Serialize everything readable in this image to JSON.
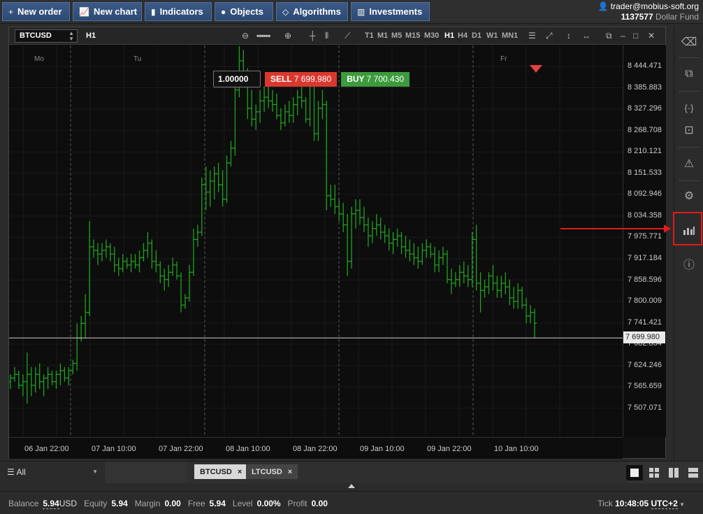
{
  "toolbar": {
    "new_order": "New order",
    "new_chart": "New chart",
    "indicators": "Indicators",
    "objects": "Objects",
    "algorithms": "Algorithms",
    "investments": "Investments"
  },
  "account": {
    "user": "trader@mobius-soft.org",
    "number": "1137577",
    "fund": "Dollar Fund"
  },
  "chart": {
    "symbol": "BTCUSD",
    "timeframe": "H1",
    "timeframes": [
      "T1",
      "M1",
      "M5",
      "M15",
      "M30",
      "H1",
      "H4",
      "D1",
      "W1",
      "MN1"
    ],
    "active_timeframe": "H1",
    "quantity": "1.00000",
    "sell_label": "SELL",
    "sell_price": "7 699.980",
    "buy_label": "BUY",
    "buy_price": "7 700.430",
    "current_price": "7 699.980",
    "price_labels": [
      "8 444.471",
      "8 385.883",
      "8 327.296",
      "8 268.708",
      "8 210.121",
      "8 151.533",
      "8 092.946",
      "8 034.358",
      "7 975.771",
      "7 917.184",
      "7 858.596",
      "7 800.009",
      "7 741.421",
      "7 682.834",
      "7 624.246",
      "7 565.659",
      "7 507.071"
    ],
    "time_labels": [
      "06 Jan 22:00",
      "07 Jan 10:00",
      "07 Jan 22:00",
      "08 Jan 10:00",
      "08 Jan 22:00",
      "09 Jan 10:00",
      "09 Jan 22:00",
      "10 Jan 10:00"
    ],
    "day_labels": [
      "Mo",
      "Tu",
      "Fr"
    ]
  },
  "chart_data": {
    "type": "ohlc",
    "symbol": "BTCUSD",
    "timeframe": "H1",
    "ylim": [
      7470,
      8470
    ],
    "color": "#1fa31f",
    "current_price": 7699.98,
    "ohlc": [
      [
        7580,
        7600,
        7560,
        7590
      ],
      [
        7590,
        7620,
        7580,
        7600
      ],
      [
        7600,
        7610,
        7560,
        7570
      ],
      [
        7570,
        7600,
        7540,
        7580
      ],
      [
        7580,
        7660,
        7520,
        7600
      ],
      [
        7600,
        7620,
        7540,
        7570
      ],
      [
        7570,
        7620,
        7550,
        7600
      ],
      [
        7600,
        7630,
        7560,
        7580
      ],
      [
        7580,
        7600,
        7540,
        7590
      ],
      [
        7590,
        7620,
        7560,
        7600
      ],
      [
        7600,
        7610,
        7570,
        7580
      ],
      [
        7580,
        7610,
        7560,
        7600
      ],
      [
        7600,
        7630,
        7570,
        7610
      ],
      [
        7610,
        7620,
        7580,
        7590
      ],
      [
        7590,
        7620,
        7570,
        7610
      ],
      [
        7610,
        7640,
        7600,
        7630
      ],
      [
        7630,
        7740,
        7610,
        7700
      ],
      [
        7700,
        7760,
        7690,
        7740
      ],
      [
        7740,
        7820,
        7700,
        7770
      ],
      [
        7770,
        8020,
        7760,
        7950
      ],
      [
        7950,
        7970,
        7920,
        7940
      ],
      [
        7940,
        7960,
        7900,
        7930
      ],
      [
        7930,
        7960,
        7910,
        7940
      ],
      [
        7940,
        7970,
        7920,
        7950
      ],
      [
        7950,
        7960,
        7910,
        7930
      ],
      [
        7930,
        7950,
        7880,
        7900
      ],
      [
        7900,
        7920,
        7870,
        7890
      ],
      [
        7890,
        7930,
        7880,
        7910
      ],
      [
        7910,
        7920,
        7890,
        7900
      ],
      [
        7900,
        7930,
        7880,
        7910
      ],
      [
        7910,
        7930,
        7890,
        7900
      ],
      [
        7900,
        7940,
        7880,
        7920
      ],
      [
        7920,
        7960,
        7910,
        7940
      ],
      [
        7940,
        7990,
        7920,
        7960
      ],
      [
        7960,
        7970,
        7890,
        7910
      ],
      [
        7910,
        7940,
        7880,
        7900
      ],
      [
        7900,
        7910,
        7850,
        7870
      ],
      [
        7870,
        7890,
        7830,
        7860
      ],
      [
        7860,
        7900,
        7840,
        7880
      ],
      [
        7880,
        7920,
        7870,
        7900
      ],
      [
        7900,
        7910,
        7860,
        7870
      ],
      [
        7870,
        7880,
        7770,
        7790
      ],
      [
        7790,
        7820,
        7780,
        7810
      ],
      [
        7810,
        7900,
        7800,
        7880
      ],
      [
        7880,
        8000,
        7870,
        7970
      ],
      [
        7970,
        8010,
        7950,
        7990
      ],
      [
        7990,
        8140,
        7980,
        8120
      ],
      [
        8120,
        8170,
        8050,
        8100
      ],
      [
        8100,
        8160,
        8060,
        8130
      ],
      [
        8130,
        8170,
        8080,
        8150
      ],
      [
        8150,
        8180,
        8100,
        8120
      ],
      [
        8120,
        8160,
        8060,
        8080
      ],
      [
        8080,
        8200,
        8070,
        8180
      ],
      [
        8180,
        8240,
        8170,
        8220
      ],
      [
        8220,
        8410,
        8200,
        8380
      ],
      [
        8380,
        8500,
        8360,
        8460
      ],
      [
        8460,
        8490,
        8400,
        8420
      ],
      [
        8420,
        8440,
        8300,
        8330
      ],
      [
        8330,
        8380,
        8280,
        8300
      ],
      [
        8300,
        8340,
        8270,
        8320
      ],
      [
        8320,
        8380,
        8290,
        8350
      ],
      [
        8350,
        8390,
        8320,
        8360
      ],
      [
        8360,
        8400,
        8330,
        8350
      ],
      [
        8350,
        8380,
        8320,
        8340
      ],
      [
        8340,
        8370,
        8300,
        8310
      ],
      [
        8310,
        8330,
        8270,
        8290
      ],
      [
        8290,
        8340,
        8280,
        8320
      ],
      [
        8320,
        8350,
        8290,
        8310
      ],
      [
        8310,
        8360,
        8290,
        8340
      ],
      [
        8340,
        8380,
        8310,
        8360
      ],
      [
        8360,
        8400,
        8330,
        8350
      ],
      [
        8350,
        8360,
        8290,
        8300
      ],
      [
        8300,
        8410,
        8280,
        8390
      ],
      [
        8390,
        8400,
        8240,
        8260
      ],
      [
        8260,
        8350,
        8240,
        8330
      ],
      [
        8330,
        8380,
        8300,
        8340
      ],
      [
        8340,
        8350,
        8050,
        8090
      ],
      [
        8090,
        8120,
        8060,
        8080
      ],
      [
        8080,
        8120,
        8040,
        8060
      ],
      [
        8060,
        8080,
        8020,
        8040
      ],
      [
        8040,
        8070,
        7990,
        8010
      ],
      [
        8010,
        8040,
        7870,
        7910
      ],
      [
        7910,
        8060,
        7890,
        8040
      ],
      [
        8040,
        8080,
        8000,
        8050
      ],
      [
        8050,
        8080,
        8010,
        8030
      ],
      [
        8030,
        8060,
        7990,
        8010
      ],
      [
        8010,
        8030,
        7950,
        7980
      ],
      [
        7980,
        8020,
        7960,
        8000
      ],
      [
        8000,
        8040,
        7980,
        8010
      ],
      [
        8010,
        8030,
        7970,
        7990
      ],
      [
        7990,
        8010,
        7960,
        7980
      ],
      [
        7980,
        8000,
        7940,
        7960
      ],
      [
        7960,
        7990,
        7930,
        7970
      ],
      [
        7970,
        8000,
        7950,
        7980
      ],
      [
        7980,
        7990,
        7930,
        7950
      ],
      [
        7950,
        7980,
        7920,
        7940
      ],
      [
        7940,
        7970,
        7910,
        7930
      ],
      [
        7930,
        7960,
        7900,
        7920
      ],
      [
        7920,
        7950,
        7890,
        7910
      ],
      [
        7910,
        7960,
        7900,
        7940
      ],
      [
        7940,
        7970,
        7920,
        7950
      ],
      [
        7950,
        7960,
        7920,
        7930
      ],
      [
        7930,
        7950,
        7880,
        7900
      ],
      [
        7900,
        7940,
        7880,
        7920
      ],
      [
        7920,
        7950,
        7900,
        7930
      ],
      [
        7930,
        7940,
        7850,
        7860
      ],
      [
        7860,
        7890,
        7820,
        7850
      ],
      [
        7850,
        7880,
        7840,
        7860
      ],
      [
        7860,
        7900,
        7840,
        7880
      ],
      [
        7880,
        7910,
        7850,
        7870
      ],
      [
        7870,
        7900,
        7840,
        7860
      ],
      [
        7860,
        7990,
        7840,
        7970
      ],
      [
        7970,
        8010,
        7830,
        7850
      ],
      [
        7850,
        7880,
        7770,
        7830
      ],
      [
        7830,
        7860,
        7810,
        7840
      ],
      [
        7840,
        7880,
        7820,
        7870
      ],
      [
        7870,
        7900,
        7830,
        7850
      ],
      [
        7850,
        7870,
        7810,
        7830
      ],
      [
        7830,
        7870,
        7810,
        7850
      ],
      [
        7850,
        7880,
        7820,
        7840
      ],
      [
        7840,
        7860,
        7790,
        7810
      ],
      [
        7810,
        7840,
        7780,
        7800
      ],
      [
        7800,
        7850,
        7780,
        7830
      ],
      [
        7830,
        7840,
        7780,
        7790
      ],
      [
        7790,
        7810,
        7740,
        7760
      ],
      [
        7760,
        7790,
        7740,
        7770
      ],
      [
        7770,
        7780,
        7700,
        7740
      ]
    ]
  },
  "tabs": {
    "filter": "All",
    "items": [
      {
        "label": "BTCUSD",
        "close": "×"
      },
      {
        "label": "LTCUSD",
        "close": "×"
      }
    ]
  },
  "status": {
    "balance_label": "Balance",
    "balance": "5.94",
    "balance_ccy": "USD",
    "equity_label": "Equity",
    "equity": "5.94",
    "margin_label": "Margin",
    "margin": "0.00",
    "free_label": "Free",
    "free": "5.94",
    "level_label": "Level",
    "level": "0.00%",
    "profit_label": "Profit",
    "profit": "0.00",
    "tick_label": "Tick",
    "time": "10:48:05",
    "tz": "UTC+2"
  },
  "sidebar": {
    "icons": [
      "eraser-icon",
      "windows-icon",
      "script-icon",
      "terminal-icon",
      "warning-icon",
      "settings-icon",
      "market-data-icon",
      "info-icon"
    ]
  }
}
